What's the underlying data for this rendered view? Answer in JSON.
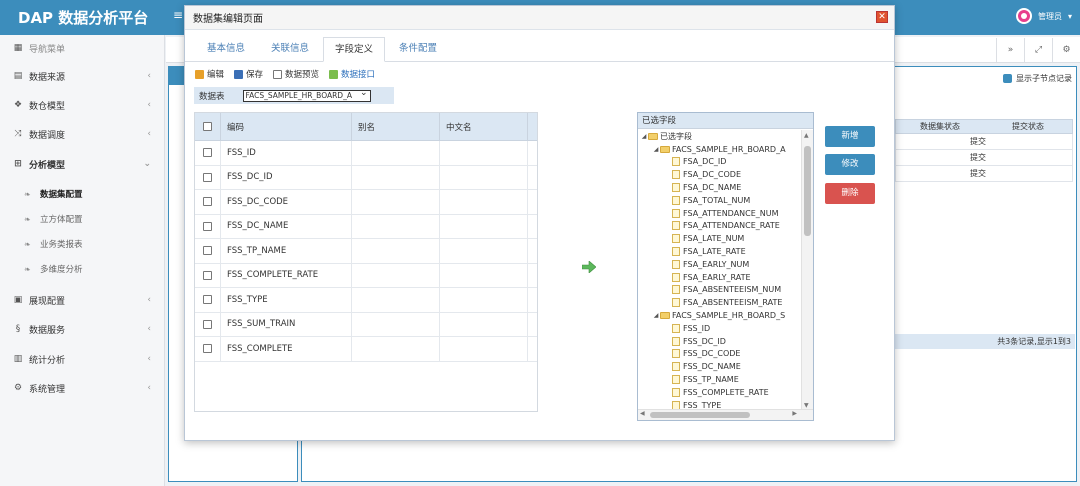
{
  "app": {
    "title": "DAP 数据分析平台",
    "user": "管理员"
  },
  "sidebar": {
    "nav_header": "导航菜单",
    "items": [
      {
        "label": "数据来源"
      },
      {
        "label": "数仓模型"
      },
      {
        "label": "数据调度"
      },
      {
        "label": "分析模型"
      },
      {
        "label": "展现配置"
      },
      {
        "label": "数据服务"
      },
      {
        "label": "统计分析"
      },
      {
        "label": "系统管理"
      }
    ],
    "sub_items": [
      {
        "label": "数据集配置"
      },
      {
        "label": "立方体配置"
      },
      {
        "label": "业务类报表"
      },
      {
        "label": "多维度分析"
      }
    ]
  },
  "background": {
    "show_child_records": "显示子节点记录",
    "columns": [
      "数据集状态",
      "提交状态"
    ],
    "rows": [
      "提交",
      "提交",
      "提交"
    ],
    "footer": "共3条记录,显示1到3"
  },
  "modal": {
    "title": "数据集编辑页面",
    "tabs": [
      {
        "label": "基本信息"
      },
      {
        "label": "关联信息"
      },
      {
        "label": "字段定义"
      },
      {
        "label": "条件配置"
      }
    ],
    "toolbar": {
      "edit": "编辑",
      "save": "保存",
      "preview": "数据预览",
      "interface": "数据接口"
    },
    "table_label": "数据表",
    "table_value": "FACS_SAMPLE_HR_BOARD_A",
    "grid": {
      "headers": [
        "编码",
        "别名",
        "中文名"
      ],
      "rows": [
        "FSS_ID",
        "FSS_DC_ID",
        "FSS_DC_CODE",
        "FSS_DC_NAME",
        "FSS_TP_NAME",
        "FSS_COMPLETE_RATE",
        "FSS_TYPE",
        "FSS_SUM_TRAIN",
        "FSS_COMPLETE"
      ]
    },
    "tree": {
      "title": "已选字段",
      "root": "已选字段",
      "group1": "FACS_SAMPLE_HR_BOARD_A",
      "group1_fields": [
        "FSA_DC_ID",
        "FSA_DC_CODE",
        "FSA_DC_NAME",
        "FSA_TOTAL_NUM",
        "FSA_ATTENDANCE_NUM",
        "FSA_ATTENDANCE_RATE",
        "FSA_LATE_NUM",
        "FSA_LATE_RATE",
        "FSA_EARLY_NUM",
        "FSA_EARLY_RATE",
        "FSA_ABSENTEEISM_NUM",
        "FSA_ABSENTEEISM_RATE"
      ],
      "group2": "FACS_SAMPLE_HR_BOARD_S",
      "group2_fields": [
        "FSS_ID",
        "FSS_DC_ID",
        "FSS_DC_CODE",
        "FSS_DC_NAME",
        "FSS_TP_NAME",
        "FSS_COMPLETE_RATE",
        "FSS_TYPE"
      ]
    },
    "actions": {
      "add": "新增",
      "modify": "修改",
      "delete": "删除"
    },
    "colors": {
      "primary": "#3c8dbc",
      "danger": "#d9534f"
    }
  }
}
